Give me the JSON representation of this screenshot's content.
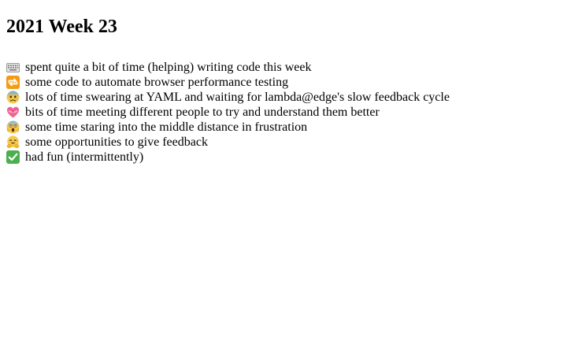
{
  "post": {
    "title": "2021 Week 23",
    "entries": [
      {
        "icon": "keyboard-icon",
        "text": "spent quite a bit of time (helping) writing code this week"
      },
      {
        "icon": "repeat-icon",
        "text": "some code to automate browser performance testing"
      },
      {
        "icon": "anxious-face-icon",
        "text": "lots of time swearing at YAML and waiting for lambda@edge's slow feedback cycle"
      },
      {
        "icon": "heart-ribbon-icon",
        "text": "bits of time meeting different people to try and understand them better"
      },
      {
        "icon": "screaming-face-icon",
        "text": "some time staring into the middle distance in frustration"
      },
      {
        "icon": "hugging-face-icon",
        "text": "some opportunities to give feedback"
      },
      {
        "icon": "check-mark-button-icon",
        "text": "had fun (intermittently)"
      }
    ]
  }
}
